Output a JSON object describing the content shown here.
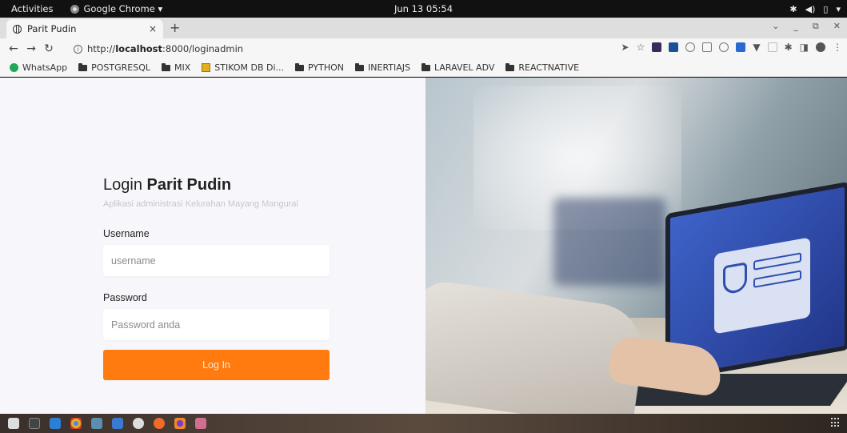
{
  "topbar": {
    "activities": "Activities",
    "app_name": "Google Chrome ▾",
    "clock": "Jun 13 05:54"
  },
  "browser": {
    "tab_title": "Parit Pudin",
    "tab_close": "×",
    "new_tab": "+",
    "url_prefix": "http://",
    "url_host": "localhost",
    "url_rest": ":8000/loginadmin"
  },
  "bookmarks": [
    {
      "label": "WhatsApp",
      "icon": "whatsapp-icon"
    },
    {
      "label": "POSTGRESQL",
      "icon": "folder-icon"
    },
    {
      "label": "MIX",
      "icon": "folder-icon"
    },
    {
      "label": "STIKOM DB Di...",
      "icon": "stikom-icon"
    },
    {
      "label": "PYTHON",
      "icon": "folder-icon"
    },
    {
      "label": "INERTIAJS",
      "icon": "folder-icon"
    },
    {
      "label": "LARAVEL ADV",
      "icon": "folder-icon"
    },
    {
      "label": "REACTNATIVE",
      "icon": "folder-icon"
    }
  ],
  "login": {
    "title_prefix": "Login ",
    "title_brand": "Parit Pudin",
    "subtitle": "Aplikasi administrasi Kelurahan Mayang Mangurai",
    "username_label": "Username",
    "username_placeholder": "username",
    "username_value": "",
    "password_label": "Password",
    "password_placeholder": "Password anda",
    "password_value": "",
    "button_label": "Log In"
  },
  "colors": {
    "accent": "#ff7b0f",
    "page_bg": "#f7f7fb"
  }
}
